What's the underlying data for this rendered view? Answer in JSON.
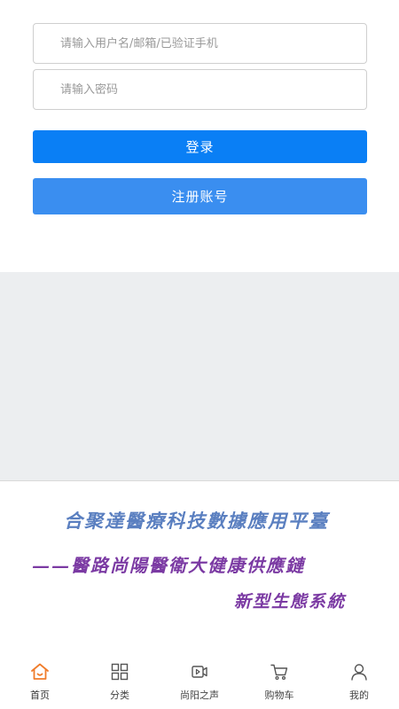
{
  "login": {
    "username_placeholder": "请输入用户名/邮箱/已验证手机",
    "username_value": "",
    "password_placeholder": "请输入密码",
    "password_value": "",
    "login_label": "登录",
    "register_label": "注册账号"
  },
  "banner": {
    "line1": "合聚達醫療科技數據應用平臺",
    "line2": "——醫路尚陽醫衛大健康供應鏈",
    "line3": "新型生態系統"
  },
  "tabbar": {
    "items": [
      {
        "label": "首页",
        "icon": "home-icon",
        "active": true
      },
      {
        "label": "分类",
        "icon": "grid-icon",
        "active": false
      },
      {
        "label": "尚阳之声",
        "icon": "video-icon",
        "active": false
      },
      {
        "label": "购物车",
        "icon": "cart-icon",
        "active": false
      },
      {
        "label": "我的",
        "icon": "user-icon",
        "active": false
      }
    ]
  },
  "colors": {
    "primary": "#0a7ff5",
    "secondary": "#3a8ef0",
    "active_icon": "#f07c2a",
    "banner_blue": "#5a7fc0",
    "banner_purple": "#7b3aa3"
  }
}
